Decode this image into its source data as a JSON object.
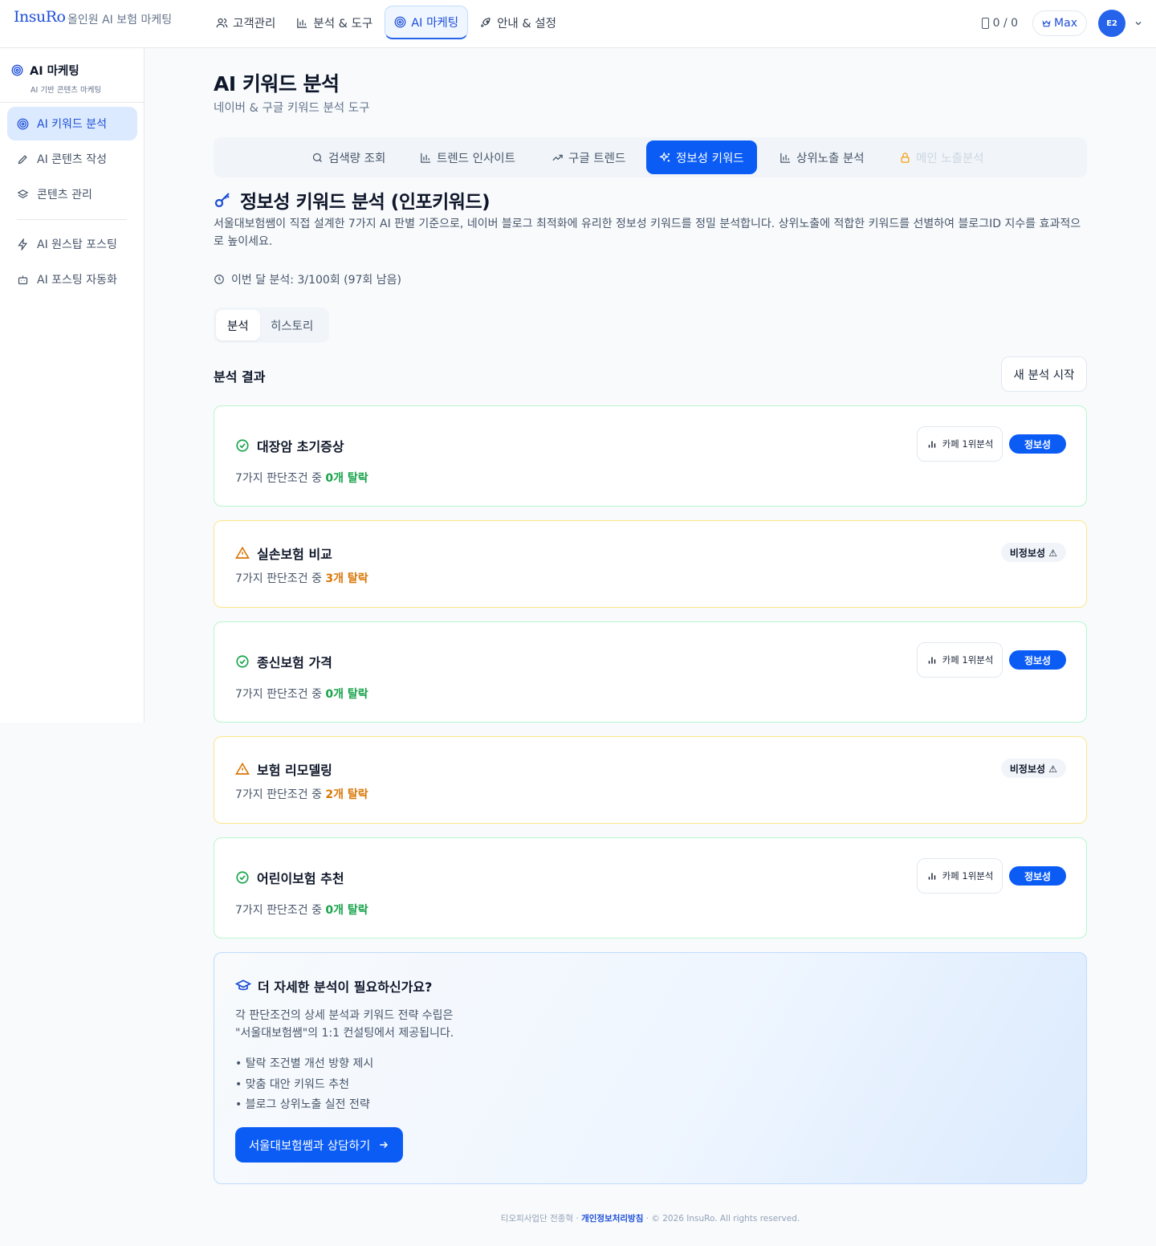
{
  "header": {
    "logo": "InsuRo",
    "tagline": "올인원 AI 보험 마케팅",
    "nav": [
      "고객관리",
      "분석 & 도구",
      "AI 마케팅",
      "안내 & 설정"
    ],
    "count": "0 / 0",
    "plan": "Max",
    "avatar": "E2"
  },
  "sidebar": {
    "title": "AI 마케팅",
    "subtitle": "AI 기반 콘텐츠 마케팅",
    "items": [
      "AI 키워드 분석",
      "AI 콘텐츠 작성",
      "콘텐츠 관리",
      "AI 원스탑 포스팅",
      "AI 포스팅 자동화"
    ]
  },
  "page": {
    "title": "AI 키워드 분석",
    "subtitle": "네이버 & 구글 키워드 분석 도구"
  },
  "tabs": [
    "검색량 조회",
    "트렌드 인사이트",
    "구글 트렌드",
    "정보성 키워드",
    "상위노출 분석",
    "메인 노출분석"
  ],
  "section": {
    "title": "정보성 키워드 분석 (인포키워드)",
    "description": "서울대보험쌤이 직접 설계한 7가지 AI 판별 기준으로, 네이버 블로그 최적화에 유리한 정보성 키워드를 정밀 분석합니다. 상위노출에 적합한 키워드를 선별하여 블로그ID 지수를 효과적으로 높이세요.",
    "quota": "이번 달 분석: 3/100회 (97회 남음)"
  },
  "segments": [
    "분석",
    "히스토리"
  ],
  "results": {
    "title": "분석 결과",
    "new_button": "새 분석 시작",
    "meta_prefix": "7가지 판단조건 중 ",
    "cafe_label": "카페 1위분석",
    "items": [
      {
        "keyword": "대장암 초기증상",
        "fail": "0개 탈락",
        "badge": "정보성"
      },
      {
        "keyword": "실손보험 비교",
        "fail": "3개 탈락",
        "badge": "비정보성 ⚠"
      },
      {
        "keyword": "종신보험 가격",
        "fail": "0개 탈락",
        "badge": "정보성"
      },
      {
        "keyword": "보험 리모델링",
        "fail": "2개 탈락",
        "badge": "비정보성 ⚠"
      },
      {
        "keyword": "어린이보험 추천",
        "fail": "0개 탈락",
        "badge": "정보성"
      }
    ]
  },
  "promo": {
    "title": "더 자세한 분석이 필요하신가요?",
    "line1": "각 판단조건의 상세 분석과 키워드 전략 수립은",
    "line2": "\"서울대보험쌤\"의 1:1 컨설팅에서 제공됩니다.",
    "bullets": [
      "탈락 조건별 개선 방향 제시",
      "맞춤 대안 키워드 추천",
      "블로그 상위노출 실전 전략"
    ],
    "button": "서울대보험쌤과 상담하기"
  },
  "footer": {
    "company": "티오피사업단 전종혁 ·",
    "privacy": "개인정보처리방침",
    "copyright": "· © 2026 InsuRo. All rights reserved."
  },
  "colors": {
    "accent": "#0b5cf5",
    "success": "#16a34a",
    "warning": "#d97706",
    "info_border": "#bbf7d0",
    "warn_border": "#fde68a"
  }
}
